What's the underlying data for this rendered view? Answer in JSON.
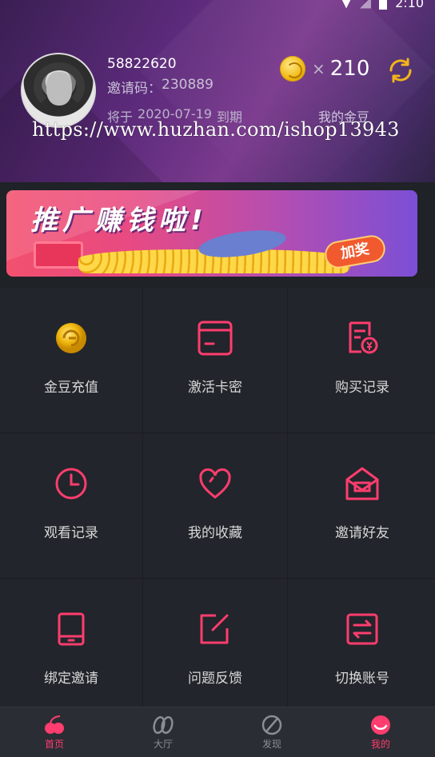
{
  "status_bar": {
    "time": "2:10"
  },
  "profile": {
    "user_id": "58822620",
    "invite_label": "邀请码：",
    "invite_code": "230889",
    "expire_prefix": "将于",
    "expire_date": "2020-07-19",
    "expire_suffix": "到期",
    "beans_label": "我的金豆",
    "times": "×",
    "bean_count": "210"
  },
  "watermark": "https://www.huzhan.com/ishop13943",
  "banner": {
    "title": "推广赚钱啦!",
    "badge": "加奖"
  },
  "grid": [
    {
      "label": "金豆充值",
      "icon": "gold-coin-icon"
    },
    {
      "label": "激活卡密",
      "icon": "card-icon"
    },
    {
      "label": "购买记录",
      "icon": "receipt-icon"
    },
    {
      "label": "观看记录",
      "icon": "clock-icon"
    },
    {
      "label": "我的收藏",
      "icon": "heart-icon"
    },
    {
      "label": "邀请好友",
      "icon": "invite-envelope-icon"
    },
    {
      "label": "绑定邀请",
      "icon": "tablet-icon"
    },
    {
      "label": "问题反馈",
      "icon": "edit-icon"
    },
    {
      "label": "切换账号",
      "icon": "switch-icon"
    }
  ],
  "tabs": [
    {
      "label": "首页",
      "icon": "cherry-icon"
    },
    {
      "label": "大厅",
      "icon": "hall-icon"
    },
    {
      "label": "发现",
      "icon": "discover-icon"
    },
    {
      "label": "我的",
      "icon": "me-icon"
    }
  ],
  "colors": {
    "accent": "#ff3d6e",
    "background": "#22252b",
    "header_purple": "#5b2a7a",
    "coin": "#f1b80f"
  }
}
